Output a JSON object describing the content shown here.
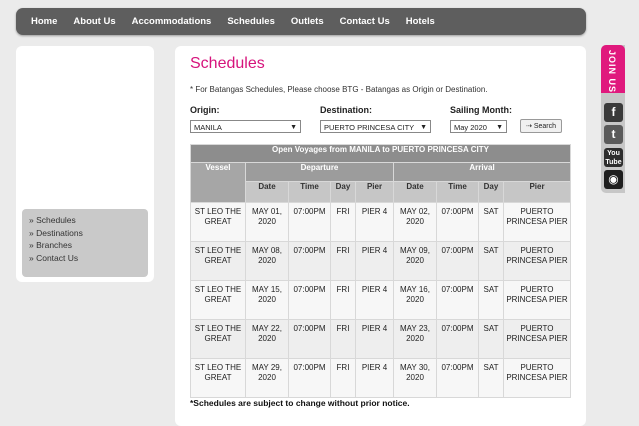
{
  "nav": [
    "Home",
    "About Us",
    "Accommodations",
    "Schedules",
    "Outlets",
    "Contact Us",
    "Hotels"
  ],
  "sidebar": [
    "» Schedules",
    "» Destinations",
    "» Branches",
    "» Contact Us"
  ],
  "page": {
    "title": "Schedules",
    "note": "* For Batangas Schedules, Please choose BTG - Batangas as Origin or Destination.",
    "origin_label": "Origin:",
    "origin_value": "MANILA",
    "destination_label": "Destination:",
    "destination_value": "PUERTO PRINCESA CITY",
    "month_label": "Sailing Month:",
    "month_value": "May 2020",
    "search_label": "Search",
    "footnote": "*Schedules are subject to change without prior notice."
  },
  "table": {
    "caption": "Open Voyages from MANILA to PUERTO PRINCESA CITY",
    "vessel_header": "Vessel",
    "departure_header": "Departure",
    "arrival_header": "Arrival",
    "sub_headers": [
      "Date",
      "Time",
      "Day",
      "Pier",
      "Date",
      "Time",
      "Day",
      "Pier"
    ],
    "rows": [
      {
        "vessel": "ST LEO THE GREAT",
        "dep_date": "MAY 01, 2020",
        "dep_time": "07:00PM",
        "dep_day": "FRI",
        "dep_pier": "PIER 4",
        "arr_date": "MAY 02, 2020",
        "arr_time": "07:00PM",
        "arr_day": "SAT",
        "arr_pier": "PUERTO PRINCESA PIER"
      },
      {
        "vessel": "ST LEO THE GREAT",
        "dep_date": "MAY 08, 2020",
        "dep_time": "07:00PM",
        "dep_day": "FRI",
        "dep_pier": "PIER 4",
        "arr_date": "MAY 09, 2020",
        "arr_time": "07:00PM",
        "arr_day": "SAT",
        "arr_pier": "PUERTO PRINCESA PIER"
      },
      {
        "vessel": "ST LEO THE GREAT",
        "dep_date": "MAY 15, 2020",
        "dep_time": "07:00PM",
        "dep_day": "FRI",
        "dep_pier": "PIER 4",
        "arr_date": "MAY 16, 2020",
        "arr_time": "07:00PM",
        "arr_day": "SAT",
        "arr_pier": "PUERTO PRINCESA PIER"
      },
      {
        "vessel": "ST LEO THE GREAT",
        "dep_date": "MAY 22, 2020",
        "dep_time": "07:00PM",
        "dep_day": "FRI",
        "dep_pier": "PIER 4",
        "arr_date": "MAY 23, 2020",
        "arr_time": "07:00PM",
        "arr_day": "SAT",
        "arr_pier": "PUERTO PRINCESA PIER"
      },
      {
        "vessel": "ST LEO THE GREAT",
        "dep_date": "MAY 29, 2020",
        "dep_time": "07:00PM",
        "dep_day": "FRI",
        "dep_pier": "PIER 4",
        "arr_date": "MAY 30, 2020",
        "arr_time": "07:00PM",
        "arr_day": "SAT",
        "arr_pier": "PUERTO PRINCESA PIER"
      }
    ]
  },
  "social": {
    "join_label": "JOIN US",
    "icons": [
      "facebook-icon",
      "twitter-icon",
      "youtube-icon",
      "instagram-icon"
    ],
    "youtube_text": "You Tube",
    "accent": "#e0197d"
  }
}
